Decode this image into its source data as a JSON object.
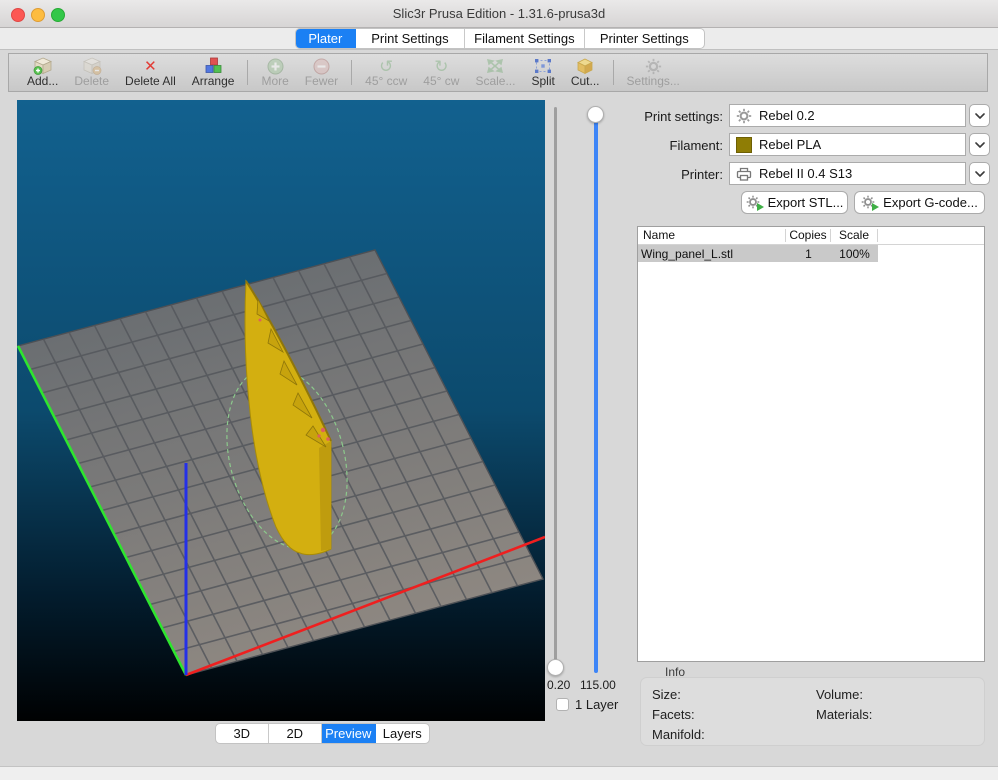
{
  "window": {
    "title": "Slic3r Prusa Edition - 1.31.6-prusa3d"
  },
  "tabs": [
    {
      "label": "Plater",
      "active": true
    },
    {
      "label": "Print Settings",
      "active": false
    },
    {
      "label": "Filament Settings",
      "active": false
    },
    {
      "label": "Printer Settings",
      "active": false
    }
  ],
  "toolbar": [
    {
      "label": "Add...",
      "icon": "package-plus",
      "enabled": true
    },
    {
      "label": "Delete",
      "icon": "package-minus",
      "enabled": false
    },
    {
      "label": "Delete All",
      "icon": "red-x",
      "enabled": true
    },
    {
      "label": "Arrange",
      "icon": "colored-cubes",
      "enabled": true
    },
    {
      "label": "More",
      "icon": "plus-circle",
      "enabled": false
    },
    {
      "label": "Fewer",
      "icon": "minus-circle",
      "enabled": false
    },
    {
      "label": "45° ccw",
      "icon": "rotate-ccw",
      "enabled": false
    },
    {
      "label": "45° cw",
      "icon": "rotate-cw",
      "enabled": false
    },
    {
      "label": "Scale...",
      "icon": "scale-arrows",
      "enabled": false
    },
    {
      "label": "Split",
      "icon": "split-dots",
      "enabled": true
    },
    {
      "label": "Cut...",
      "icon": "cut-box",
      "enabled": true
    },
    {
      "label": "Settings...",
      "icon": "gear",
      "enabled": false
    }
  ],
  "layer_sliders": {
    "lower_value": "0.20",
    "upper_value": "115.00",
    "one_layer_label": "1 Layer",
    "one_layer_checked": false
  },
  "view_modes": [
    {
      "label": "3D",
      "active": false
    },
    {
      "label": "2D",
      "active": false
    },
    {
      "label": "Preview",
      "active": true
    },
    {
      "label": "Layers",
      "active": false
    }
  ],
  "settings_panel": {
    "rows": [
      {
        "label": "Print settings:",
        "value": "Rebel 0.2",
        "icon": "gear"
      },
      {
        "label": "Filament:",
        "value": "Rebel PLA",
        "icon": "filament-swatch"
      },
      {
        "label": "Printer:",
        "value": "Rebel II 0.4 S13",
        "icon": "printer"
      }
    ],
    "export_stl_label": "Export STL...",
    "export_gcode_label": "Export G-code..."
  },
  "object_table": {
    "columns": [
      "Name",
      "Copies",
      "Scale"
    ],
    "rows": [
      {
        "name": "Wing_panel_L.stl",
        "copies": "1",
        "scale": "100%",
        "selected": true
      }
    ]
  },
  "info_panel": {
    "title": "Info",
    "fields": [
      "Size:",
      "Volume:",
      "Facets:",
      "Materials:",
      "Manifold:"
    ]
  },
  "viewport": {
    "axis_colors": {
      "x": "#ef1f1f",
      "y": "#2ee52e",
      "z": "#2430e8"
    },
    "model_color": "#d3af10",
    "skirt_outline_color": "#8cc98c"
  },
  "colors": {
    "accent_blue": "#1b80f4",
    "selection_gray": "#c9c9c9"
  }
}
